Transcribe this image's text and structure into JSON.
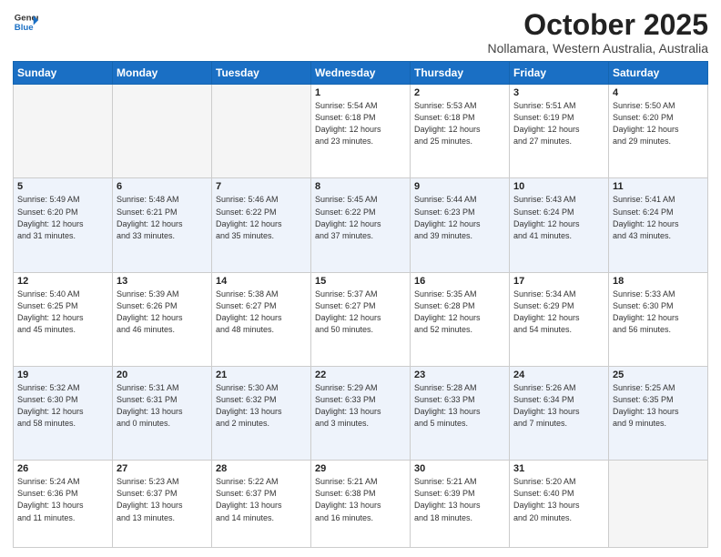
{
  "logo": {
    "line1": "General",
    "line2": "Blue"
  },
  "header": {
    "month": "October 2025",
    "location": "Nollamara, Western Australia, Australia"
  },
  "weekdays": [
    "Sunday",
    "Monday",
    "Tuesday",
    "Wednesday",
    "Thursday",
    "Friday",
    "Saturday"
  ],
  "weeks": [
    [
      {
        "day": "",
        "info": ""
      },
      {
        "day": "",
        "info": ""
      },
      {
        "day": "",
        "info": ""
      },
      {
        "day": "1",
        "info": "Sunrise: 5:54 AM\nSunset: 6:18 PM\nDaylight: 12 hours\nand 23 minutes."
      },
      {
        "day": "2",
        "info": "Sunrise: 5:53 AM\nSunset: 6:18 PM\nDaylight: 12 hours\nand 25 minutes."
      },
      {
        "day": "3",
        "info": "Sunrise: 5:51 AM\nSunset: 6:19 PM\nDaylight: 12 hours\nand 27 minutes."
      },
      {
        "day": "4",
        "info": "Sunrise: 5:50 AM\nSunset: 6:20 PM\nDaylight: 12 hours\nand 29 minutes."
      }
    ],
    [
      {
        "day": "5",
        "info": "Sunrise: 5:49 AM\nSunset: 6:20 PM\nDaylight: 12 hours\nand 31 minutes."
      },
      {
        "day": "6",
        "info": "Sunrise: 5:48 AM\nSunset: 6:21 PM\nDaylight: 12 hours\nand 33 minutes."
      },
      {
        "day": "7",
        "info": "Sunrise: 5:46 AM\nSunset: 6:22 PM\nDaylight: 12 hours\nand 35 minutes."
      },
      {
        "day": "8",
        "info": "Sunrise: 5:45 AM\nSunset: 6:22 PM\nDaylight: 12 hours\nand 37 minutes."
      },
      {
        "day": "9",
        "info": "Sunrise: 5:44 AM\nSunset: 6:23 PM\nDaylight: 12 hours\nand 39 minutes."
      },
      {
        "day": "10",
        "info": "Sunrise: 5:43 AM\nSunset: 6:24 PM\nDaylight: 12 hours\nand 41 minutes."
      },
      {
        "day": "11",
        "info": "Sunrise: 5:41 AM\nSunset: 6:24 PM\nDaylight: 12 hours\nand 43 minutes."
      }
    ],
    [
      {
        "day": "12",
        "info": "Sunrise: 5:40 AM\nSunset: 6:25 PM\nDaylight: 12 hours\nand 45 minutes."
      },
      {
        "day": "13",
        "info": "Sunrise: 5:39 AM\nSunset: 6:26 PM\nDaylight: 12 hours\nand 46 minutes."
      },
      {
        "day": "14",
        "info": "Sunrise: 5:38 AM\nSunset: 6:27 PM\nDaylight: 12 hours\nand 48 minutes."
      },
      {
        "day": "15",
        "info": "Sunrise: 5:37 AM\nSunset: 6:27 PM\nDaylight: 12 hours\nand 50 minutes."
      },
      {
        "day": "16",
        "info": "Sunrise: 5:35 AM\nSunset: 6:28 PM\nDaylight: 12 hours\nand 52 minutes."
      },
      {
        "day": "17",
        "info": "Sunrise: 5:34 AM\nSunset: 6:29 PM\nDaylight: 12 hours\nand 54 minutes."
      },
      {
        "day": "18",
        "info": "Sunrise: 5:33 AM\nSunset: 6:30 PM\nDaylight: 12 hours\nand 56 minutes."
      }
    ],
    [
      {
        "day": "19",
        "info": "Sunrise: 5:32 AM\nSunset: 6:30 PM\nDaylight: 12 hours\nand 58 minutes."
      },
      {
        "day": "20",
        "info": "Sunrise: 5:31 AM\nSunset: 6:31 PM\nDaylight: 13 hours\nand 0 minutes."
      },
      {
        "day": "21",
        "info": "Sunrise: 5:30 AM\nSunset: 6:32 PM\nDaylight: 13 hours\nand 2 minutes."
      },
      {
        "day": "22",
        "info": "Sunrise: 5:29 AM\nSunset: 6:33 PM\nDaylight: 13 hours\nand 3 minutes."
      },
      {
        "day": "23",
        "info": "Sunrise: 5:28 AM\nSunset: 6:33 PM\nDaylight: 13 hours\nand 5 minutes."
      },
      {
        "day": "24",
        "info": "Sunrise: 5:26 AM\nSunset: 6:34 PM\nDaylight: 13 hours\nand 7 minutes."
      },
      {
        "day": "25",
        "info": "Sunrise: 5:25 AM\nSunset: 6:35 PM\nDaylight: 13 hours\nand 9 minutes."
      }
    ],
    [
      {
        "day": "26",
        "info": "Sunrise: 5:24 AM\nSunset: 6:36 PM\nDaylight: 13 hours\nand 11 minutes."
      },
      {
        "day": "27",
        "info": "Sunrise: 5:23 AM\nSunset: 6:37 PM\nDaylight: 13 hours\nand 13 minutes."
      },
      {
        "day": "28",
        "info": "Sunrise: 5:22 AM\nSunset: 6:37 PM\nDaylight: 13 hours\nand 14 minutes."
      },
      {
        "day": "29",
        "info": "Sunrise: 5:21 AM\nSunset: 6:38 PM\nDaylight: 13 hours\nand 16 minutes."
      },
      {
        "day": "30",
        "info": "Sunrise: 5:21 AM\nSunset: 6:39 PM\nDaylight: 13 hours\nand 18 minutes."
      },
      {
        "day": "31",
        "info": "Sunrise: 5:20 AM\nSunset: 6:40 PM\nDaylight: 13 hours\nand 20 minutes."
      },
      {
        "day": "",
        "info": ""
      }
    ]
  ]
}
